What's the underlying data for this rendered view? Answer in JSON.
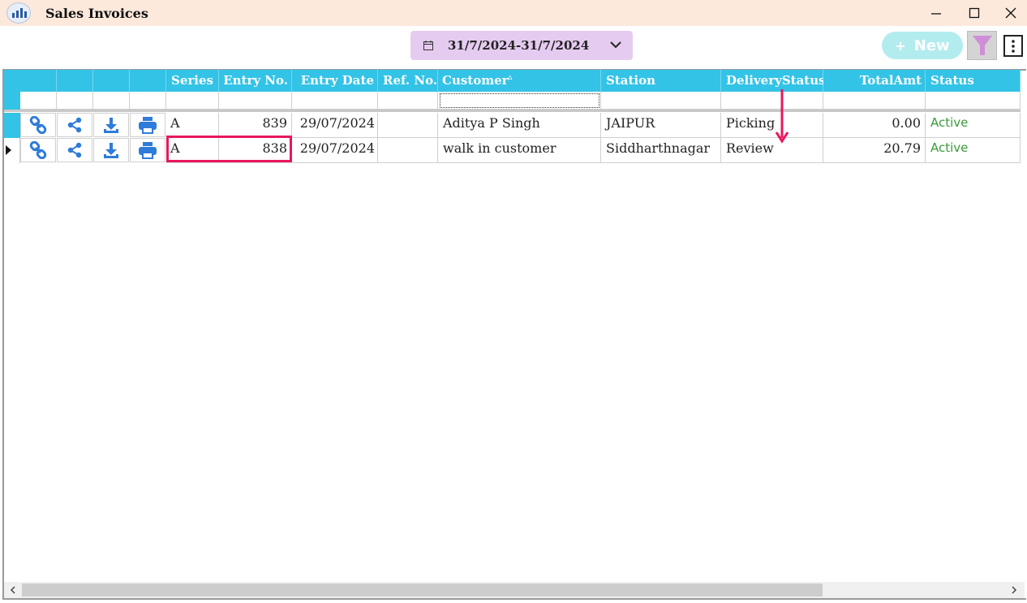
{
  "window": {
    "title": "Sales Invoices"
  },
  "toolbar": {
    "date_range": "31/7/2024-31/7/2024",
    "new_label": "New"
  },
  "grid": {
    "columns": [
      "Series",
      "Entry No.",
      "Entry Date",
      "Ref. No.",
      "Customer",
      "Station",
      "DeliveryStatus",
      "TotalAmt",
      "Status"
    ],
    "customer_sort_indicator": "▵",
    "rows": [
      {
        "series": "A",
        "entry_no": "839",
        "entry_date": "29/07/2024",
        "ref_no": "",
        "customer": "Aditya P Singh",
        "station": "JAIPUR",
        "delivery_status": "Picking",
        "total_amt": "0.00",
        "status": "Active"
      },
      {
        "series": "A",
        "entry_no": "838",
        "entry_date": "29/07/2024",
        "ref_no": "",
        "customer": "walk in customer",
        "station": "Siddharthnagar",
        "delivery_status": "Review",
        "total_amt": "20.79",
        "status": "Active"
      }
    ]
  },
  "icons": {
    "row_actions": [
      "link-icon",
      "share-icon",
      "download-icon",
      "print-icon"
    ],
    "filter": "funnel-icon",
    "more": "vertical-dots-icon",
    "calendar": "calendar-icon"
  },
  "colors": {
    "header_bg": "#33c3e6",
    "titlebar_bg": "#fde9dc",
    "date_pill_bg": "#e6cbf0",
    "new_button_bg": "#b3ecef",
    "active_status": "#3a9a3a",
    "annotation": "#e8175d",
    "icon_blue": "#2f7bd9"
  }
}
